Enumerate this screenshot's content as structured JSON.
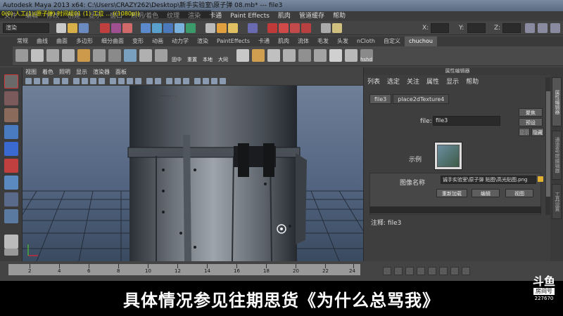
{
  "window": {
    "title": "Autodesk Maya 2013 x64: C:\\Users\\CRAZY262\\Desktop\\新手实验室\\原子弹 08.mb* --- file3",
    "overlay_line": "0(0) 人工(1)(原子弹) 时间组01 (1) 工位 ... ((1080p))"
  },
  "menubar": [
    "文件",
    "编辑",
    "修改",
    "创建",
    "显示",
    "窗口",
    "照明/着色",
    "纹理",
    "渲染",
    "卡通",
    "Paint Effects",
    "肌肉",
    "管道缓存",
    "帮助"
  ],
  "statusline": {
    "mode": "渲染",
    "x_label": "X:",
    "y_label": "Y:",
    "z_label": "Z:"
  },
  "shelf": {
    "tabs": [
      "常规",
      "曲线",
      "曲面",
      "多边形",
      "细分曲面",
      "变形",
      "动画",
      "动力学",
      "渲染",
      "PaintEffects",
      "卡通",
      "肌肉",
      "流体",
      "毛发",
      "头发",
      "nCloth",
      "自定义",
      "chuchou"
    ],
    "active_tab": "chuchou",
    "labels": [
      "固中",
      "重置",
      "本地",
      "大同"
    ],
    "hshd_label": "hshd"
  },
  "viewport": {
    "menu": [
      "视图",
      "着色",
      "照明",
      "显示",
      "渲染器",
      "面板"
    ],
    "label_tiny": "···········  ·  ·"
  },
  "attribute_editor": {
    "title": "属性编辑器",
    "menu": [
      "列表",
      "选定",
      "关注",
      "属性",
      "显示",
      "帮助"
    ],
    "tabs": [
      "file3",
      "place2dTexture4"
    ],
    "buttons": {
      "focus": "聚焦",
      "presets": "预设",
      "show": "显示",
      "hide": "隐藏",
      "reload": "重新加载",
      "edit": "编辑",
      "view": "视图"
    },
    "file_label": "file:",
    "file_value": "file3",
    "sample_label": "示例",
    "image_name_label": "图像名称",
    "image_name_value": "诚手实验室\\原子弹 贴图\\高光贴图.png",
    "note_label": "注释:",
    "note_value": "file3"
  },
  "right_tabs": [
    "属性编辑器",
    "通道盒/层编辑器",
    "工具设置"
  ],
  "timeslider": {
    "ticks": [
      "2",
      "4",
      "6",
      "8",
      "10",
      "12",
      "14",
      "16",
      "18",
      "20",
      "22",
      "24"
    ]
  },
  "subtitle": "具体情况参见往期思货《为什么总骂我》",
  "watermark": {
    "name": "房间号",
    "id": "227670"
  },
  "colors": {
    "ui_bg": "#444444",
    "viewport_top": "#6f7f98",
    "accent_yellow": "#e8e800"
  }
}
